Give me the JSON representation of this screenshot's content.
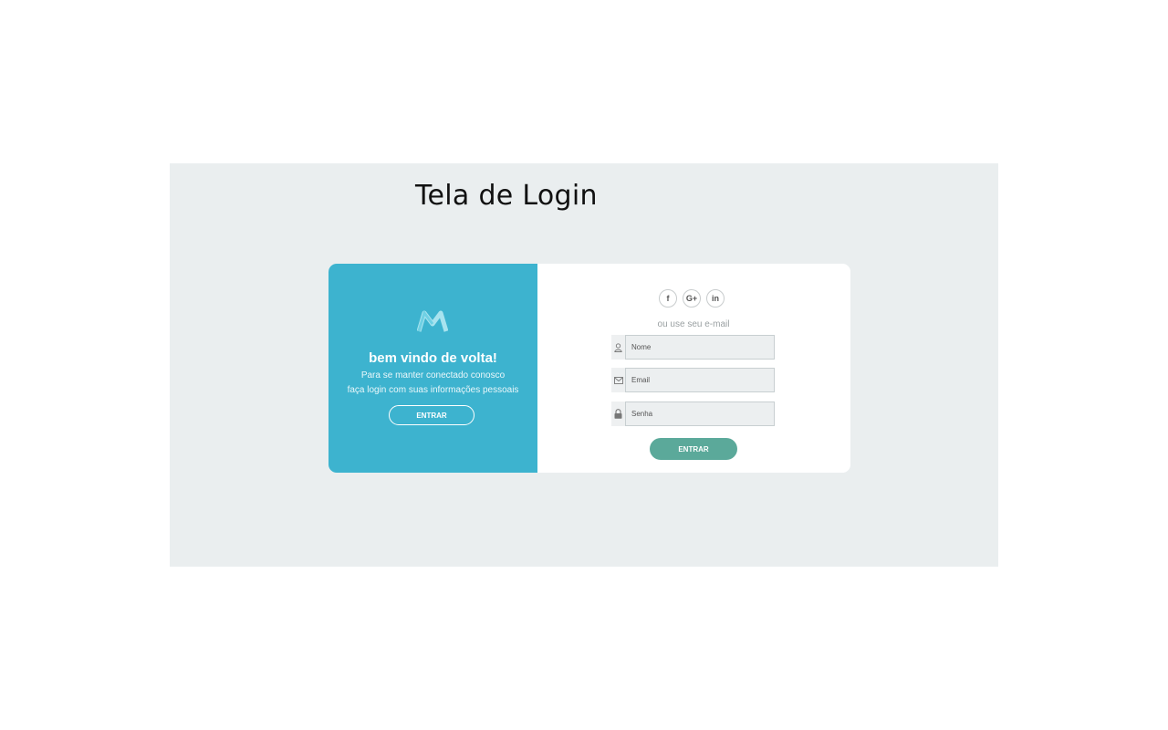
{
  "page": {
    "title": "Tela de Login"
  },
  "left_panel": {
    "logo_icon": "m-logo-icon",
    "heading": "bem vindo de volta!",
    "line1": "Para se manter conectado conosco",
    "line2": "faça login com suas informações pessoais",
    "button_label": "ENTRAR",
    "background": "#3db3cf"
  },
  "right_panel": {
    "socials": [
      {
        "icon": "facebook-icon",
        "glyph": "f"
      },
      {
        "icon": "google-plus-icon",
        "glyph": "G+"
      },
      {
        "icon": "linkedin-icon",
        "glyph": "in"
      }
    ],
    "or_text": "ou use seu e-mail",
    "fields": {
      "name": {
        "placeholder": "Nome",
        "icon": "user-icon"
      },
      "email": {
        "placeholder": "Email",
        "icon": "envelope-icon"
      },
      "password": {
        "placeholder": "Senha",
        "icon": "lock-icon"
      }
    },
    "submit_label": "ENTRAR",
    "accent": "#5ba99a"
  }
}
